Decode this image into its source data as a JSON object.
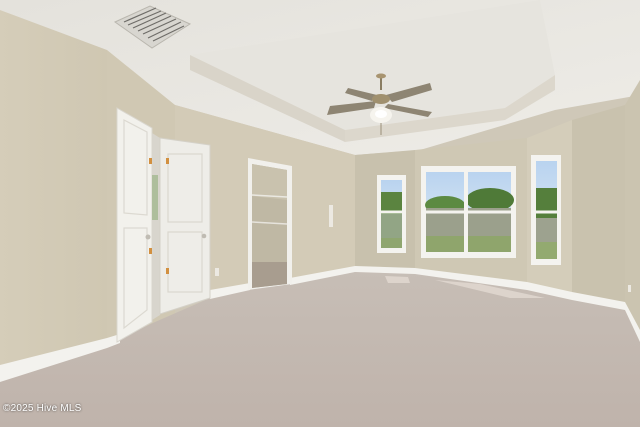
{
  "photo": {
    "watermark": "©2025 Hive MLS"
  },
  "palette": {
    "wall": "#d2cbb7",
    "wall_shadow": "#c4bda8",
    "ceiling": "#e9e7e1",
    "tray": "#e2ddd2",
    "carpet": "#c9beb6",
    "trim": "#f4f3ef",
    "glass_sky": "#a8c6e6",
    "foliage": "#4f7a38"
  }
}
